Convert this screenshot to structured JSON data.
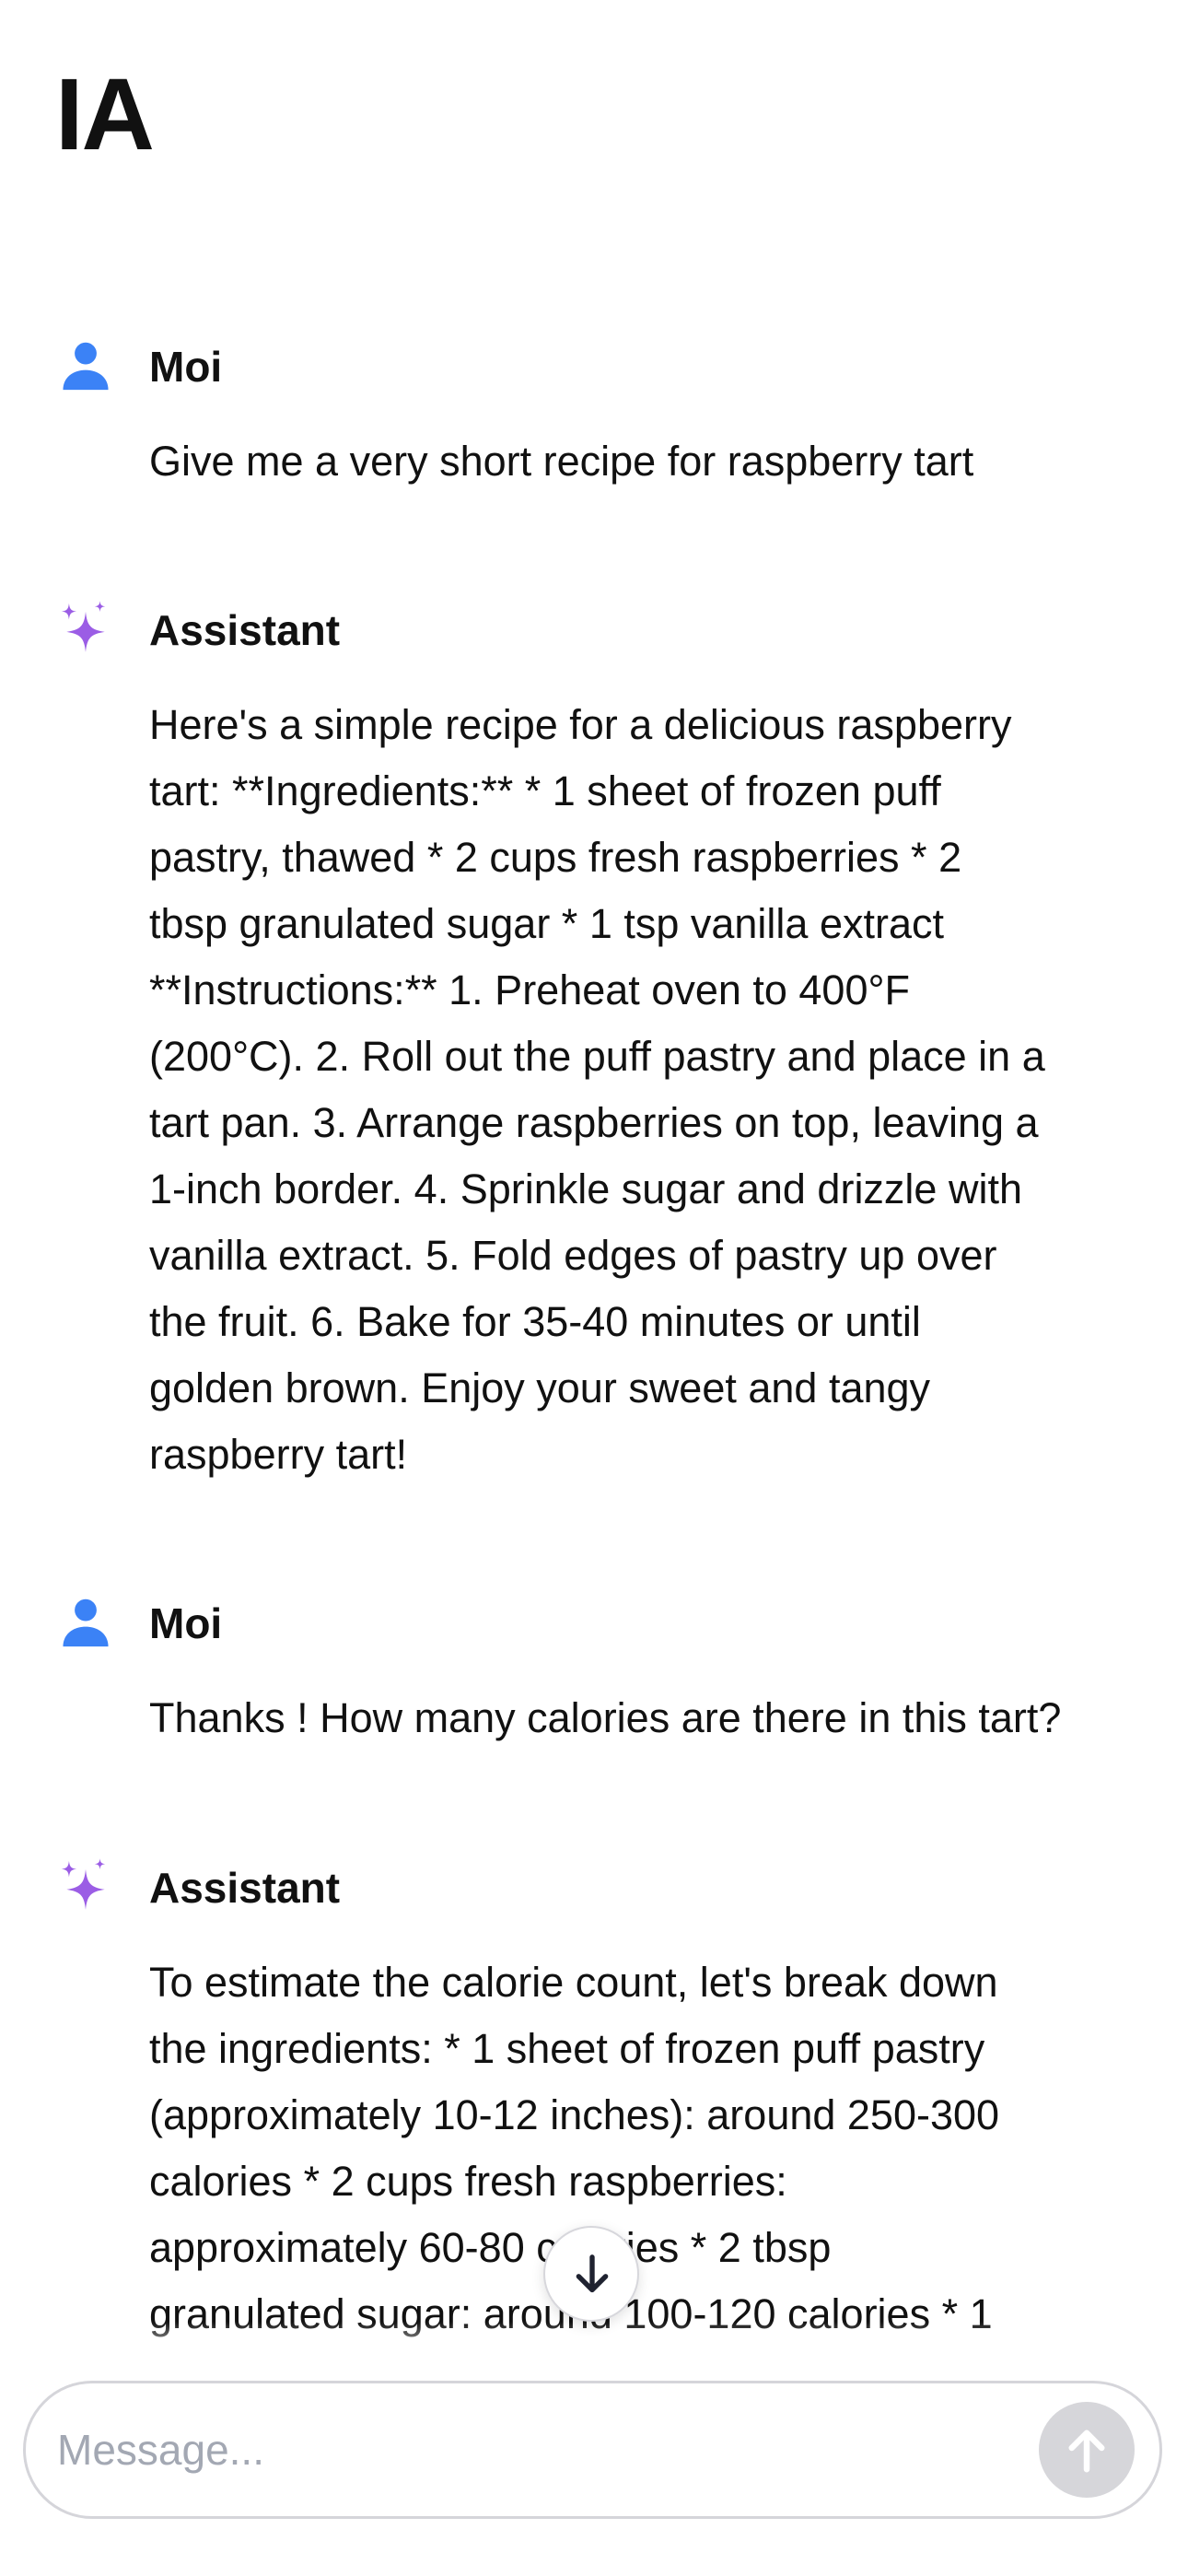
{
  "app": {
    "title": "IA"
  },
  "messages": [
    {
      "role": "user",
      "sender": "Moi",
      "icon": "person-icon",
      "text": "Give me a very short recipe for raspberry tart"
    },
    {
      "role": "assistant",
      "sender": "Assistant",
      "icon": "sparkle-icon",
      "text": "Here's a simple recipe for a delicious raspberry\ntart: **Ingredients:** * 1 sheet of frozen puff\npastry, thawed * 2 cups fresh raspberries * 2\ntbsp granulated sugar * 1 tsp vanilla extract\n**Instructions:** 1. Preheat oven to 400°F\n(200°C). 2. Roll out the puff pastry and place in a\ntart pan. 3. Arrange raspberries on top, leaving a\n1-inch border. 4. Sprinkle sugar and drizzle with\nvanilla extract. 5. Fold edges of pastry up over\nthe fruit. 6. Bake for 35-40 minutes or until\ngolden brown. Enjoy your sweet and tangy\nraspberry tart!"
    },
    {
      "role": "user",
      "sender": "Moi",
      "icon": "person-icon",
      "text": "Thanks ! How many calories are there in this tart?"
    },
    {
      "role": "assistant",
      "sender": "Assistant",
      "icon": "sparkle-icon",
      "text": "To estimate the calorie count, let's break down\nthe ingredients: * 1 sheet of frozen puff pastry\n(approximately 10-12 inches): around 250-300\ncalories * 2 cups fresh raspberries:\napproximately 60-80 calories * 2 tbsp\ngranulated sugar: around 100-120 calories * 1"
    }
  ],
  "composer": {
    "placeholder": "Message...",
    "value": "",
    "send_icon": "arrow-up-icon"
  },
  "scroll_button": {
    "icon": "arrow-down-icon"
  },
  "colors": {
    "user_icon": "#3b82f6",
    "assistant_icon": "#9b5de5",
    "send_button": "#d6d6da",
    "placeholder": "#a3a8b3"
  }
}
